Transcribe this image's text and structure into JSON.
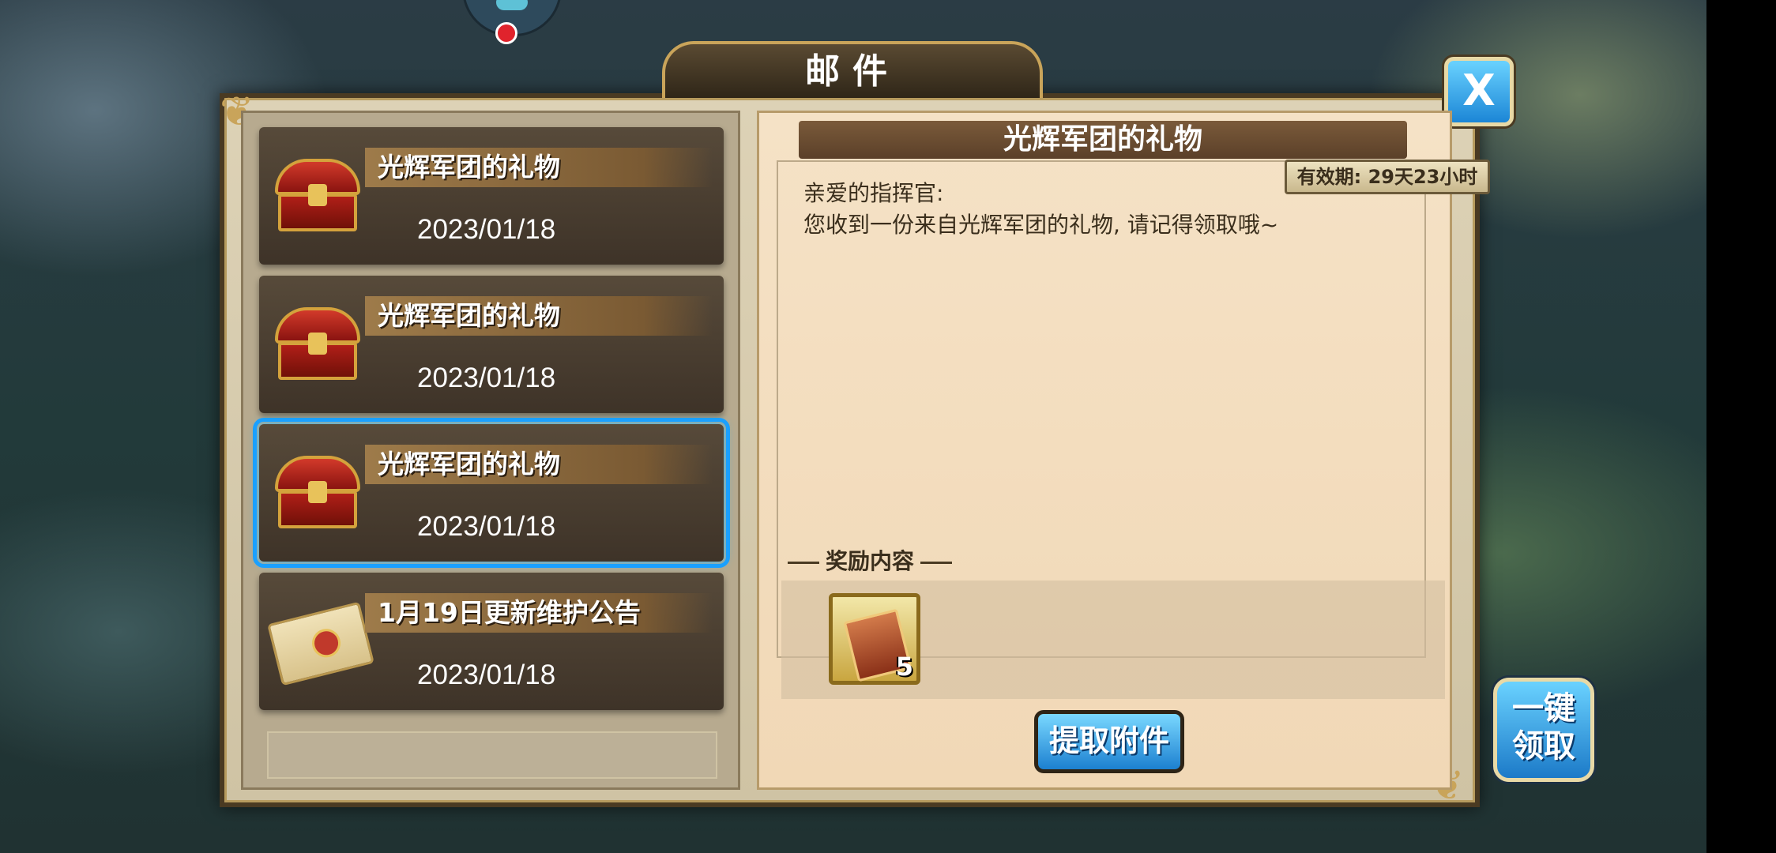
{
  "title": "邮件",
  "close_label": "X",
  "mails": [
    {
      "subject": "光辉军团的礼物",
      "date": "2023/01/18",
      "icon": "chest-icon"
    },
    {
      "subject": "光辉军团的礼物",
      "date": "2023/01/18",
      "icon": "chest-icon"
    },
    {
      "subject": "光辉军团的礼物",
      "date": "2023/01/18",
      "icon": "chest-icon",
      "selected": true
    },
    {
      "subject": "1月19日更新维护公告",
      "date": "2023/01/18",
      "icon": "envelope-icon"
    }
  ],
  "detail": {
    "subject": "光辉军团的礼物",
    "expiry": "有效期: 29天23小时",
    "greeting": "亲爱的指挥官:",
    "body": "您收到一份来自光辉军团的礼物, 请记得领取哦~",
    "reward_title": "奖励内容",
    "rewards": [
      {
        "icon": "ticket-card-icon",
        "qty": "5"
      }
    ],
    "claim_label": "提取附件"
  },
  "claim_all": {
    "line1": "一键",
    "line2": "领取"
  },
  "colors": {
    "accent_blue": "#1aa0ff",
    "panel_brown": "#4a3a22",
    "gold": "#c9a45a"
  }
}
